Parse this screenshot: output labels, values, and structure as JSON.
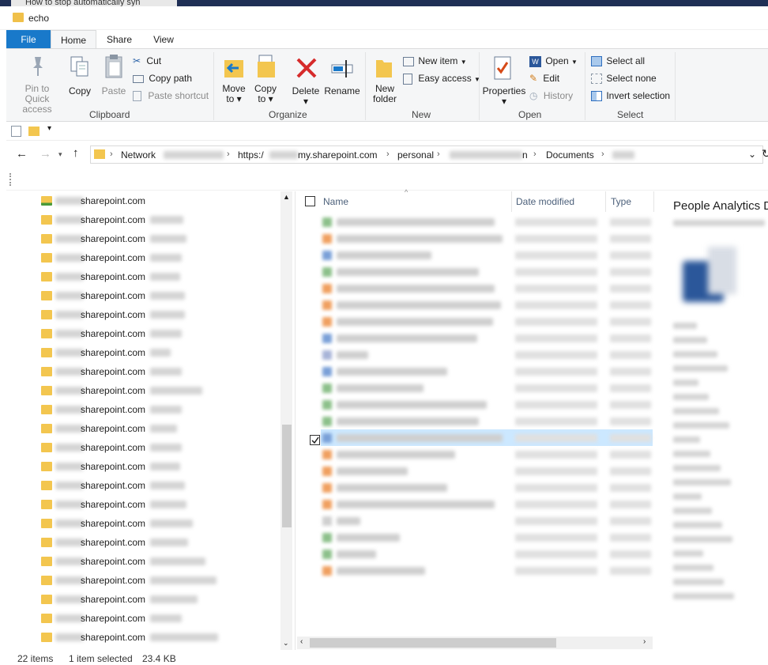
{
  "browser_tab": {
    "title": "How to stop automatically syn"
  },
  "window": {
    "title": "echo"
  },
  "menu": {
    "file": "File",
    "home": "Home",
    "share": "Share",
    "view": "View"
  },
  "ribbon": {
    "clipboard": {
      "label": "Clipboard",
      "pin": [
        "Pin to Quick",
        "access"
      ],
      "copy": "Copy",
      "paste": "Paste",
      "cut": "Cut",
      "copy_path": "Copy path",
      "paste_shortcut": "Paste shortcut"
    },
    "organize": {
      "label": "Organize",
      "move_to": [
        "Move",
        "to"
      ],
      "copy_to": [
        "Copy",
        "to"
      ],
      "delete": "Delete",
      "rename": "Rename"
    },
    "new": {
      "label": "New",
      "new_folder": [
        "New",
        "folder"
      ],
      "new_item": "New item",
      "easy_access": "Easy access"
    },
    "open": {
      "label": "Open",
      "properties": "Properties",
      "open": "Open",
      "edit": "Edit",
      "history": "History"
    },
    "select": {
      "label": "Select",
      "select_all": "Select all",
      "select_none": "Select none",
      "invert_selection": "Invert selection"
    }
  },
  "address": {
    "crumbs": [
      "Network",
      "https:/",
      "my.sharepoint.com",
      "personal",
      "n",
      "Documents"
    ]
  },
  "nav": {
    "item_text": "sharepoint.com",
    "count_rows": 24
  },
  "columns": {
    "name": "Name",
    "date_modified": "Date modified",
    "type": "Type"
  },
  "preview": {
    "title": "People Analytics D"
  },
  "status": {
    "items": "22 items",
    "selected": "1 item selected",
    "size": "23.4 KB"
  },
  "colors": {
    "accent": "#1979ca",
    "folder": "#f3c64f",
    "selected_row": "#cce8ff"
  }
}
